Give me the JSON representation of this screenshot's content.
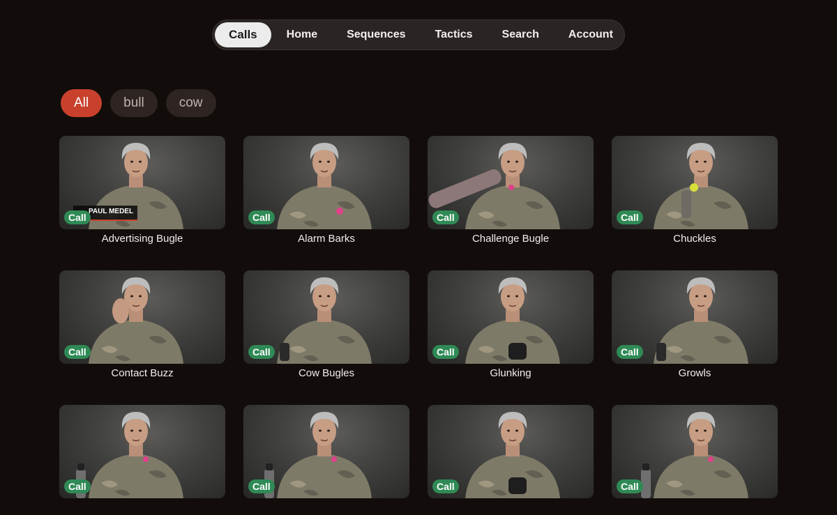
{
  "nav": {
    "tabs": [
      {
        "label": "Calls",
        "active": true
      },
      {
        "label": "Home",
        "active": false
      },
      {
        "label": "Sequences",
        "active": false
      },
      {
        "label": "Tactics",
        "active": false
      },
      {
        "label": "Search",
        "active": false
      },
      {
        "label": "Account",
        "active": false
      }
    ]
  },
  "filters": {
    "chips": [
      {
        "label": "All",
        "active": true
      },
      {
        "label": "bull",
        "active": false
      },
      {
        "label": "cow",
        "active": false
      }
    ]
  },
  "colors": {
    "background": "#120d0b",
    "accent": "#c9412d",
    "badge": "#2f8a55"
  },
  "grid": {
    "items": [
      {
        "title": "Advertising Bugle",
        "badge": "Call",
        "overlay_name": "PAUL MEDEL",
        "prop": "none"
      },
      {
        "title": "Alarm Barks",
        "badge": "Call",
        "prop": "pink-reed"
      },
      {
        "title": "Challenge Bugle",
        "badge": "Call",
        "prop": "tube"
      },
      {
        "title": "Chuckles",
        "badge": "Call",
        "prop": "yellow-reed"
      },
      {
        "title": "Contact Buzz",
        "badge": "Call",
        "prop": "hand-cupped"
      },
      {
        "title": "Cow Bugles",
        "badge": "Call",
        "prop": "reed"
      },
      {
        "title": "Glunking",
        "badge": "Call",
        "prop": "cup"
      },
      {
        "title": "Growls",
        "badge": "Call",
        "prop": "reed"
      },
      {
        "title": "",
        "badge": "Call",
        "prop": "bottle"
      },
      {
        "title": "",
        "badge": "Call",
        "prop": "bottle"
      },
      {
        "title": "",
        "badge": "Call",
        "prop": "cup"
      },
      {
        "title": "",
        "badge": "Call",
        "prop": "bottle"
      }
    ]
  }
}
